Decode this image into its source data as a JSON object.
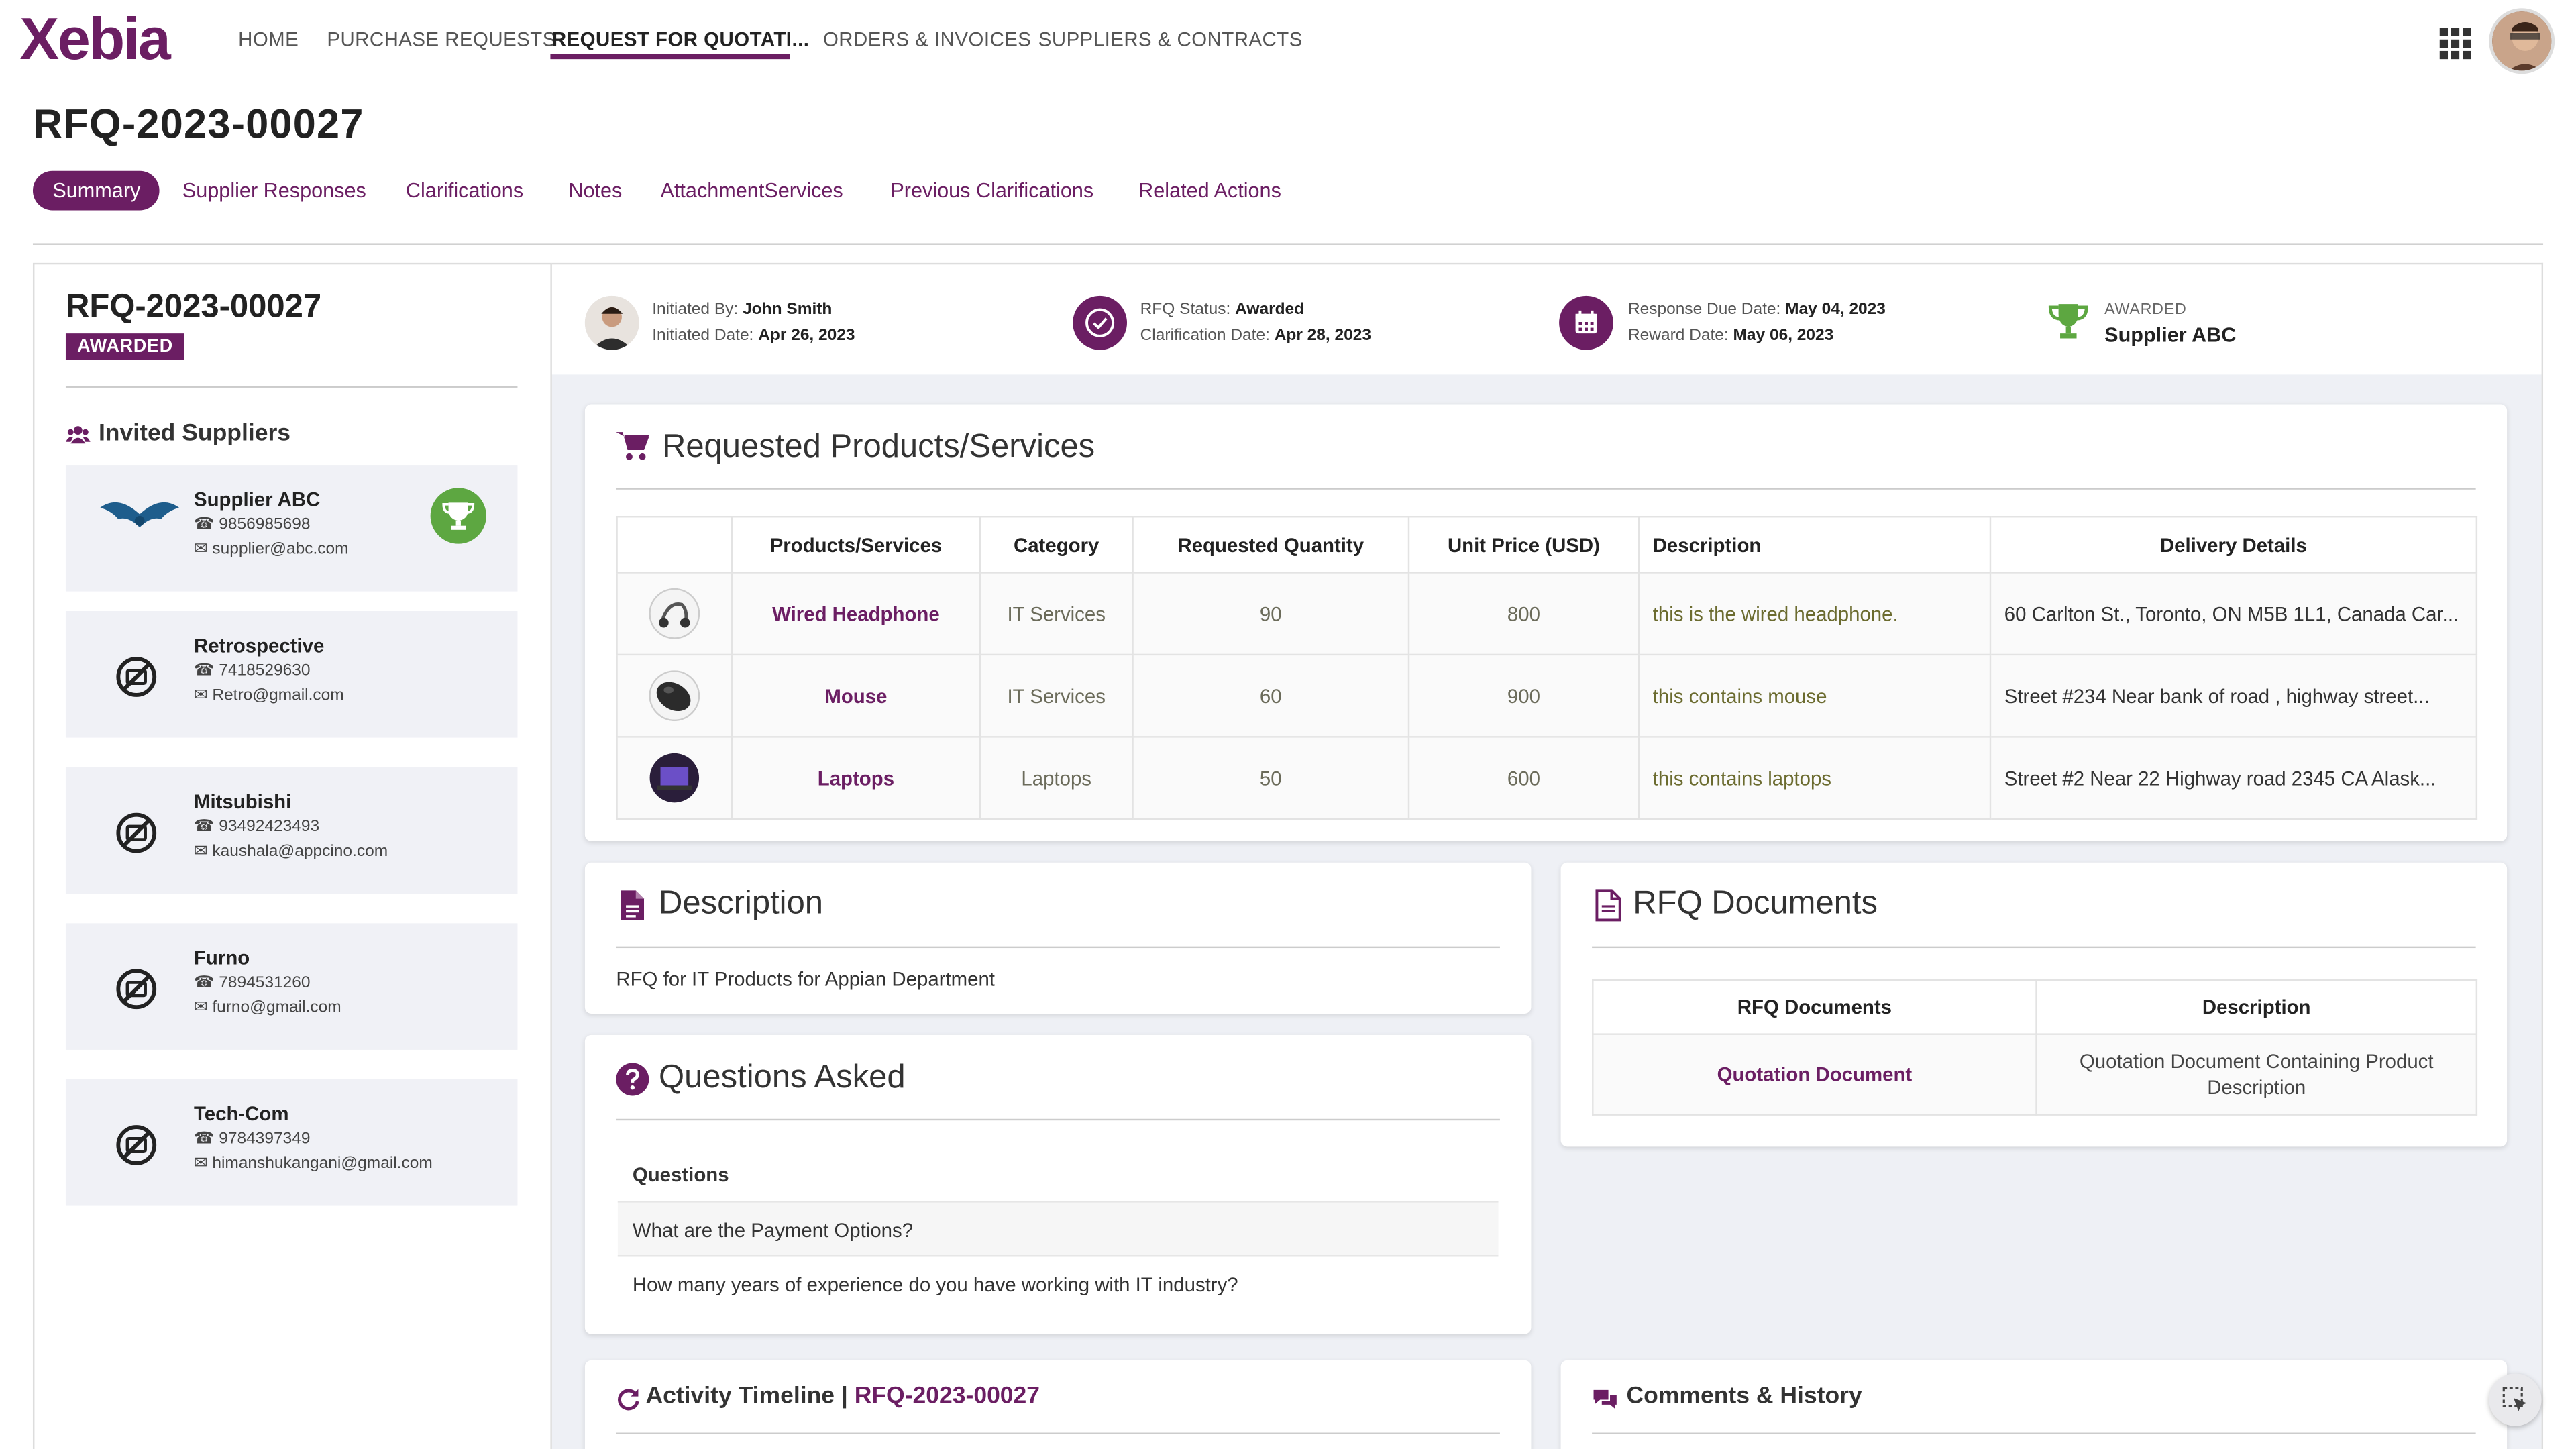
{
  "brand": {
    "logo_text": "Xebia"
  },
  "nav": {
    "items": [
      "HOME",
      "PURCHASE REQUESTS",
      "REQUEST FOR QUOTATI...",
      "ORDERS & INVOICES",
      "SUPPLIERS & CONTRACTS"
    ],
    "active_index": 2
  },
  "page": {
    "title": "RFQ-2023-00027"
  },
  "tabs": [
    "Summary",
    "Supplier Responses",
    "Clarifications",
    "Notes",
    "AttachmentServices",
    "Previous Clarifications",
    "Related Actions"
  ],
  "rfq": {
    "id": "RFQ-2023-00027",
    "status_badge": "AWARDED"
  },
  "invited": {
    "title": "Invited Suppliers",
    "suppliers": [
      {
        "name": "Supplier ABC",
        "phone": "9856985698",
        "email": "supplier@abc.com",
        "awarded": true
      },
      {
        "name": "Retrospective",
        "phone": "7418529630",
        "email": "Retro@gmail.com",
        "awarded": false
      },
      {
        "name": "Mitsubishi",
        "phone": "93492423493",
        "email": "kaushala@appcino.com",
        "awarded": false
      },
      {
        "name": "Furno",
        "phone": "7894531260",
        "email": "furno@gmail.com",
        "awarded": false
      },
      {
        "name": "Tech-Com",
        "phone": "9784397349",
        "email": "himanshukangani@gmail.com",
        "awarded": false
      }
    ]
  },
  "header_info": {
    "initiated_by_label": "Initiated By:",
    "initiated_by": "John Smith",
    "initiated_date_label": "Initiated Date:",
    "initiated_date": "Apr 26, 2023",
    "status_label": "RFQ Status:",
    "status": "Awarded",
    "clarification_label": "Clarification Date:",
    "clarification_date": "Apr 28, 2023",
    "due_label": "Response Due Date:",
    "due_date": "May 04, 2023",
    "reward_label": "Reward Date:",
    "reward_date": "May 06, 2023",
    "awarded_label": "AWARDED",
    "awarded_to": "Supplier ABC"
  },
  "products": {
    "title": "Requested Products/Services",
    "columns": [
      "Products/Services",
      "Category",
      "Requested Quantity",
      "Unit Price (USD)",
      "Description",
      "Delivery Details"
    ],
    "rows": [
      {
        "name": "Wired Headphone",
        "category": "IT Services",
        "qty": "90",
        "price": "800",
        "description": "this is the wired headphone.",
        "delivery": "60 Carlton St., Toronto, ON M5B 1L1, Canada Car..."
      },
      {
        "name": "Mouse",
        "category": "IT Services",
        "qty": "60",
        "price": "900",
        "description": "this contains mouse",
        "delivery": "Street #234 Near bank of road , highway street..."
      },
      {
        "name": "Laptops",
        "category": "Laptops",
        "qty": "50",
        "price": "600",
        "description": "this contains laptops",
        "delivery": "Street #2 Near 22 Highway road 2345 CA Alask..."
      }
    ]
  },
  "description": {
    "title": "Description",
    "text": "RFQ for IT Products for Appian Department"
  },
  "documents": {
    "title": "RFQ Documents",
    "columns": [
      "RFQ Documents",
      "Description"
    ],
    "rows": [
      {
        "name": "Quotation Document",
        "description": "Quotation Document Containing Product Description"
      }
    ]
  },
  "questions": {
    "title": "Questions Asked",
    "header": "Questions",
    "items": [
      "What are the Payment Options?",
      "How many years of experience do you have working with IT industry?"
    ]
  },
  "timeline": {
    "title": "Activity Timeline |",
    "ref": "RFQ-2023-00027"
  },
  "comments": {
    "title": "Comments & History"
  },
  "colors": {
    "brand": "#6b1e63",
    "awarded_green": "#5da741",
    "panel_bg": "#eef0f5"
  }
}
